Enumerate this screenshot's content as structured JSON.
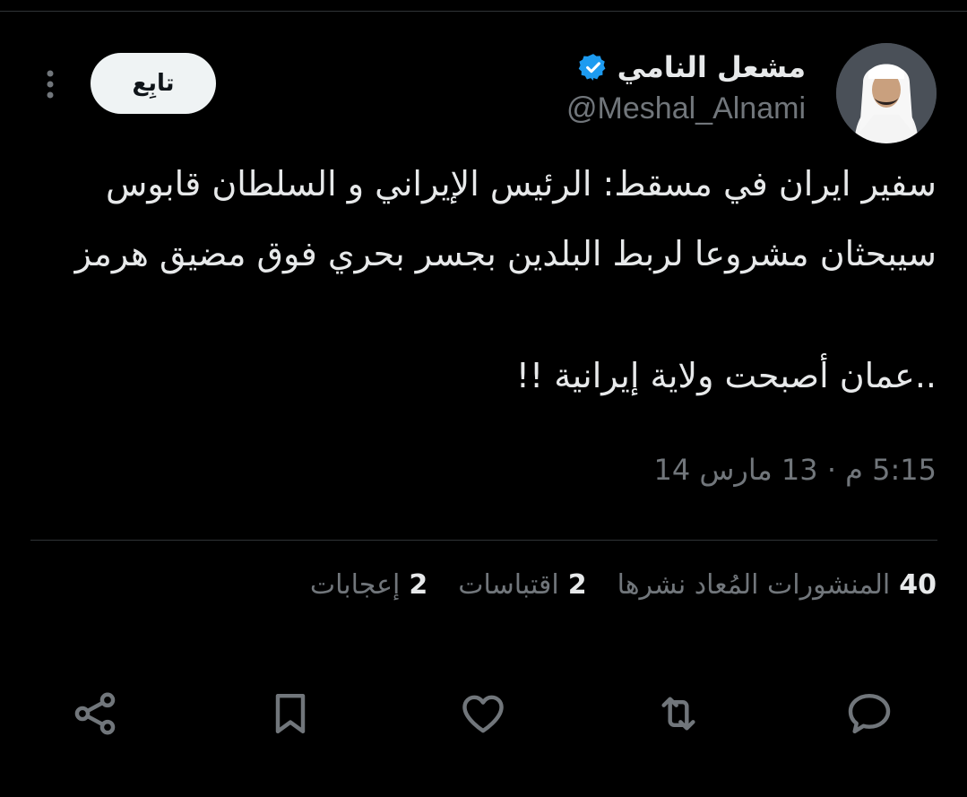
{
  "author": {
    "display_name": "مشعل النامي",
    "handle": "@Meshal_Alnami",
    "verified_icon": "verified-badge-icon",
    "avatar_icon": "profile-photo"
  },
  "header": {
    "follow_label": "تابِع",
    "more_icon": "more-vertical-icon"
  },
  "tweet": {
    "lines": [
      "سفير ايران في مسقط: الرئيس الإيراني و السلطان قابوس",
      "سيبحثان مشروعا لربط البلدين بجسر بحري فوق مضيق هرمز",
      "",
      "..عمان أصبحت ولاية إيرانية !!"
    ],
    "timestamp": "5:15 م · 13 مارس 14"
  },
  "stats": [
    {
      "count": "40",
      "label": "المنشورات المُعاد نشرها"
    },
    {
      "count": "2",
      "label": "اقتباسات"
    },
    {
      "count": "2",
      "label": "إعجابات"
    }
  ],
  "actions": [
    "reply-icon",
    "retweet-icon",
    "like-icon",
    "bookmark-icon",
    "share-icon"
  ],
  "colors": {
    "background": "#000000",
    "text": "#e7e9ea",
    "secondary": "#71767b",
    "divider": "#2f3336",
    "verified": "#1d9bf0",
    "button_bg": "#eff3f4"
  }
}
